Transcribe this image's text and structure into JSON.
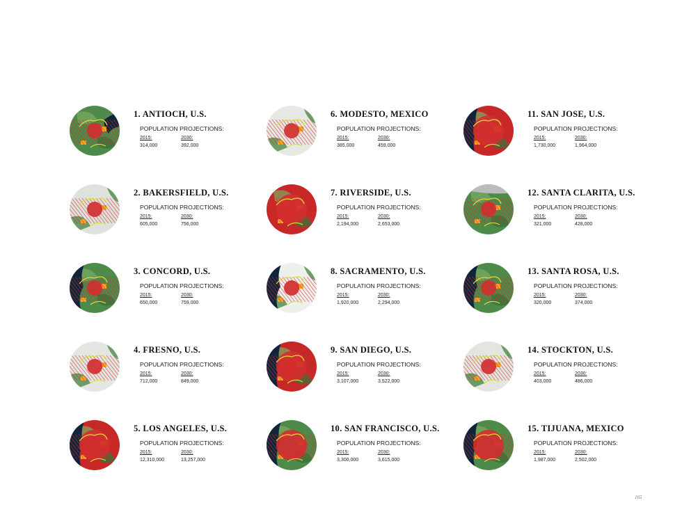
{
  "cities": [
    {
      "title": "1. ANTIOCH, U.S.",
      "heading": "POPULATION PROJECTIONS:",
      "year1": "2015:",
      "year2": "2030:",
      "value1": "314,000",
      "value2": "392,000"
    },
    {
      "title": "2. BAKERSFIELD, U.S.",
      "heading": "POPULATION PROJECTIONS:",
      "year1": "2015:",
      "year2": "2030:",
      "value1": "605,000",
      "value2": "756,000"
    },
    {
      "title": "3. CONCORD, U.S.",
      "heading": "POPULATION PROJECTIONS:",
      "year1": "2015:",
      "year2": "2030:",
      "value1": "650,000",
      "value2": "759,000"
    },
    {
      "title": "4. FRESNO, U.S.",
      "heading": "POPULATION PROJECTIONS:",
      "year1": "2015:",
      "year2": "2030:",
      "value1": "712,000",
      "value2": "849,000"
    },
    {
      "title": "5. LOS ANGELES, U.S.",
      "heading": "POPULATION PROJECTIONS:",
      "year1": "2015:",
      "year2": "2030:",
      "value1": "12,310,000",
      "value2": "13,257,000"
    },
    {
      "title": "6. MODESTO, MEXICO",
      "heading": "POPULATION PROJECTIONS:",
      "year1": "2015:",
      "year2": "2030:",
      "value1": "385,000",
      "value2": "459,000"
    },
    {
      "title": "7. RIVERSIDE, U.S.",
      "heading": "POPULATION PROJECTIONS:",
      "year1": "2015:",
      "year2": "2030:",
      "value1": "2,194,000",
      "value2": "2,653,000"
    },
    {
      "title": "8. SACRAMENTO, U.S.",
      "heading": "POPULATION PROJECTIONS:",
      "year1": "2015:",
      "year2": "2030:",
      "value1": "1,920,000",
      "value2": "2,294,000"
    },
    {
      "title": "9. SAN DIEGO, U.S.",
      "heading": "POPULATION PROJECTIONS:",
      "year1": "2015:",
      "year2": "2030:",
      "value1": "3,107,000",
      "value2": "3,522,000"
    },
    {
      "title": "10. SAN FRANCISCO, U.S.",
      "heading": "POPULATION PROJECTIONS:",
      "year1": "2015:",
      "year2": "2030:",
      "value1": "3,300,000",
      "value2": "3,615,000"
    },
    {
      "title": "11. SAN JOSE, U.S.",
      "heading": "POPULATION PROJECTIONS:",
      "year1": "2015:",
      "year2": "2030:",
      "value1": "1,730,000",
      "value2": "1,964,000"
    },
    {
      "title": "12. SANTA CLARITA, U.S.",
      "heading": "POPULATION PROJECTIONS:",
      "year1": "2015:",
      "year2": "2030:",
      "value1": "321,000",
      "value2": "428,000"
    },
    {
      "title": "13. SANTA ROSA, U.S.",
      "heading": "POPULATION PROJECTIONS:",
      "year1": "2015:",
      "year2": "2030:",
      "value1": "320,000",
      "value2": "374,000"
    },
    {
      "title": "14. STOCKTON, U.S.",
      "heading": "POPULATION PROJECTIONS:",
      "year1": "2015:",
      "year2": "2030:",
      "value1": "403,000",
      "value2": "486,000"
    },
    {
      "title": "15. TIJUANA, MEXICO",
      "heading": "POPULATION PROJECTIONS:",
      "year1": "2015:",
      "year2": "2030:",
      "value1": "1,987,000",
      "value2": "2,502,000"
    }
  ],
  "page_number": "165",
  "colors": {
    "urban": "#d32f2f",
    "green": "#4e8a4a",
    "water": "#10243a",
    "orange": "#f5a623",
    "yellow": "#d6e23a",
    "pale": "#eef0ec"
  }
}
